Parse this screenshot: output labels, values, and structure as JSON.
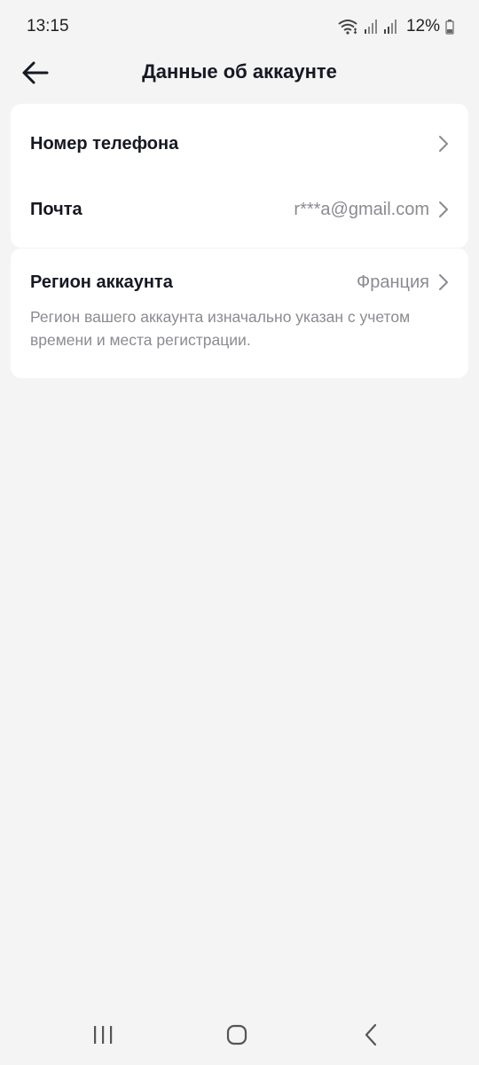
{
  "status_bar": {
    "time": "13:15",
    "battery": "12%",
    "icons": [
      "wifi-icon",
      "signal-icon",
      "signal-icon",
      "battery-icon"
    ]
  },
  "header": {
    "title": "Данные об аккаунте",
    "back_icon": "back-arrow-icon"
  },
  "account": {
    "phone_label": "Номер телефона",
    "email_label": "Почта",
    "email_value": "r***a@gmail.com"
  },
  "region": {
    "label": "Регион аккаунта",
    "value": "Франция",
    "description": "Регион вашего аккаунта изначально указан с учетом времени и места регистрации."
  },
  "nav_bar": {
    "icons": [
      "recents-icon",
      "home-icon",
      "back-icon"
    ]
  },
  "colors": {
    "background": "#f4f4f4",
    "card": "#ffffff",
    "primary_text": "#161823",
    "secondary_text": "#8a8b91"
  }
}
